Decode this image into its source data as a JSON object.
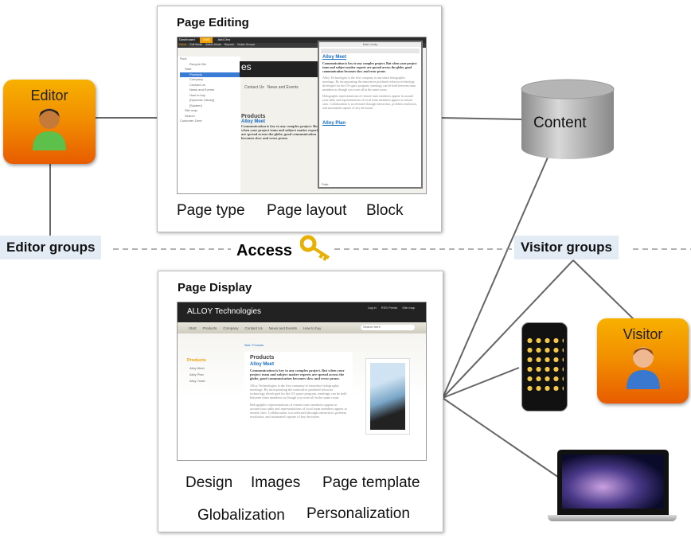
{
  "editor": {
    "label": "Editor",
    "group": "Editor groups"
  },
  "visitor": {
    "label": "Visitor",
    "group": "Visitor groups"
  },
  "access": {
    "label": "Access"
  },
  "content": {
    "label": "Content"
  },
  "page_editing": {
    "title": "Page Editing",
    "captions": [
      "Page type",
      "Page layout",
      "Block"
    ],
    "toolbar": [
      "Dashboard",
      "CMS",
      "Add-Ons"
    ],
    "menu": [
      "Home",
      "Edit Mode",
      "Admin Mode",
      "Reports",
      "Visitor Groups"
    ],
    "tree": [
      "Root",
      "Recycle Bin",
      "Start",
      "Products",
      "Company",
      "Contact Us",
      "News and Events",
      "How to buy",
      "[Dynamic Library]",
      "[System]",
      "Site map",
      "Search",
      "Customer Zone"
    ],
    "editor_title": "Main body",
    "editor_heading": "Alloy Meet",
    "editor_lead": "Communication is key to any complex project. But when your project team and subject matter experts are spread across the globe, good communication becomes slow and error prone.",
    "editor_p1": "Alloy Technologies is the first company to introduce holographic meetings. By incorporating the innovative pixilated refractor technology developed for the US space program, meetings can be held between team members as though you were all in the same room.",
    "editor_p2": "Holographic representations of remote team members appear in around your table and representations of local team members appear at remote sites. Collaboration is accelerated through interaction, problem resolution, and automated capture of key decisions",
    "editor_heading2": "Alloy Plan",
    "path_label": "Path:"
  },
  "page_display": {
    "title": "Page Display",
    "captions": [
      "Design",
      "Images",
      "Page template",
      "Globalization",
      "Personalization"
    ],
    "logo": "ALLOY Technologies",
    "top_links": [
      "Log in",
      "RSS Feeds",
      "Site map"
    ],
    "nav": [
      "Start",
      "Products",
      "Company",
      "Contact Us",
      "News and Events",
      "How to buy"
    ],
    "search_placeholder": "Search here",
    "breadcrumb": "Start / Products",
    "side_title": "Products",
    "side_items": [
      "Alloy Meet",
      "Alloy Plan",
      "Alloy Track"
    ],
    "heading": "Products",
    "subheading": "Alloy Meet",
    "lead": "Communication is key to any complex project.  But when your project team and subject matter experts are spread across the globe, good communication becomes slow and error prone.",
    "p1": "Alloy Technologies is the first company to introduce holographic meetings. By incorporating the innovative pixilated refractor technology developed for the US space program, meetings can be held between team members as though you were all in the same room.",
    "p2": "Holographic representations of remote team members appear in around your table and representations of local team members appear at remote sites. Collaboration is accelerated through interaction, problem resolution, and automated capture of key decisions"
  },
  "colors": {
    "person_orange": "#f29000",
    "group_bg": "#e3ecf5",
    "link_blue": "#1a6fc4",
    "cms_orange": "#f0a000"
  }
}
